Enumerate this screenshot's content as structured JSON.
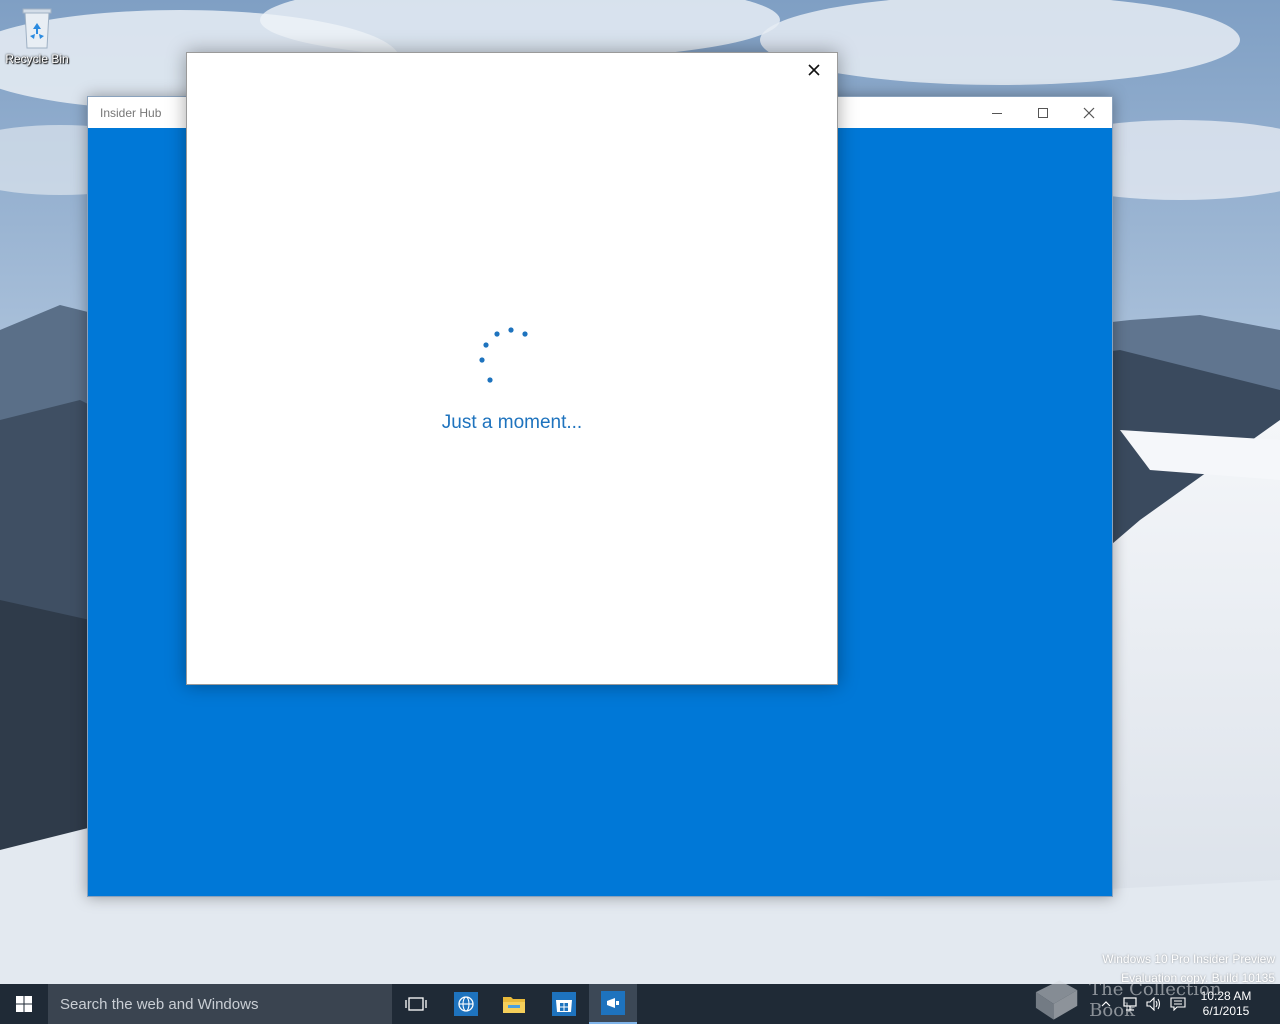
{
  "desktop": {
    "icons": [
      {
        "label": "Recycle Bin",
        "icon": "recycle-bin-icon"
      }
    ],
    "watermark": {
      "line1": "Windows 10 Pro Insider Preview",
      "line2": "Evaluation copy. Build 10135"
    }
  },
  "app_window": {
    "title": "Insider Hub",
    "accent_color": "#0078d7",
    "controls": [
      "minimize-icon",
      "maximize-icon",
      "close-icon"
    ]
  },
  "dialog": {
    "close_icon": "close-icon",
    "loading_text": "Just a moment...",
    "spinner_color": "#1e73be"
  },
  "taskbar": {
    "start_icon": "windows-logo-icon",
    "search_placeholder": "Search the web and Windows",
    "buttons": [
      {
        "name": "task-view",
        "icon": "task-view-icon"
      },
      {
        "name": "edge",
        "icon": "globe-icon"
      },
      {
        "name": "file-explorer",
        "icon": "folder-icon"
      },
      {
        "name": "store",
        "icon": "store-icon"
      },
      {
        "name": "insider-hub",
        "icon": "megaphone-icon",
        "active": true
      }
    ],
    "tray": {
      "icons": [
        "chevron-up-icon",
        "network-icon",
        "volume-icon",
        "action-center-icon"
      ],
      "time": "10:28 AM",
      "date": "6/1/2015"
    },
    "overlay_text": "The Collection Book"
  }
}
